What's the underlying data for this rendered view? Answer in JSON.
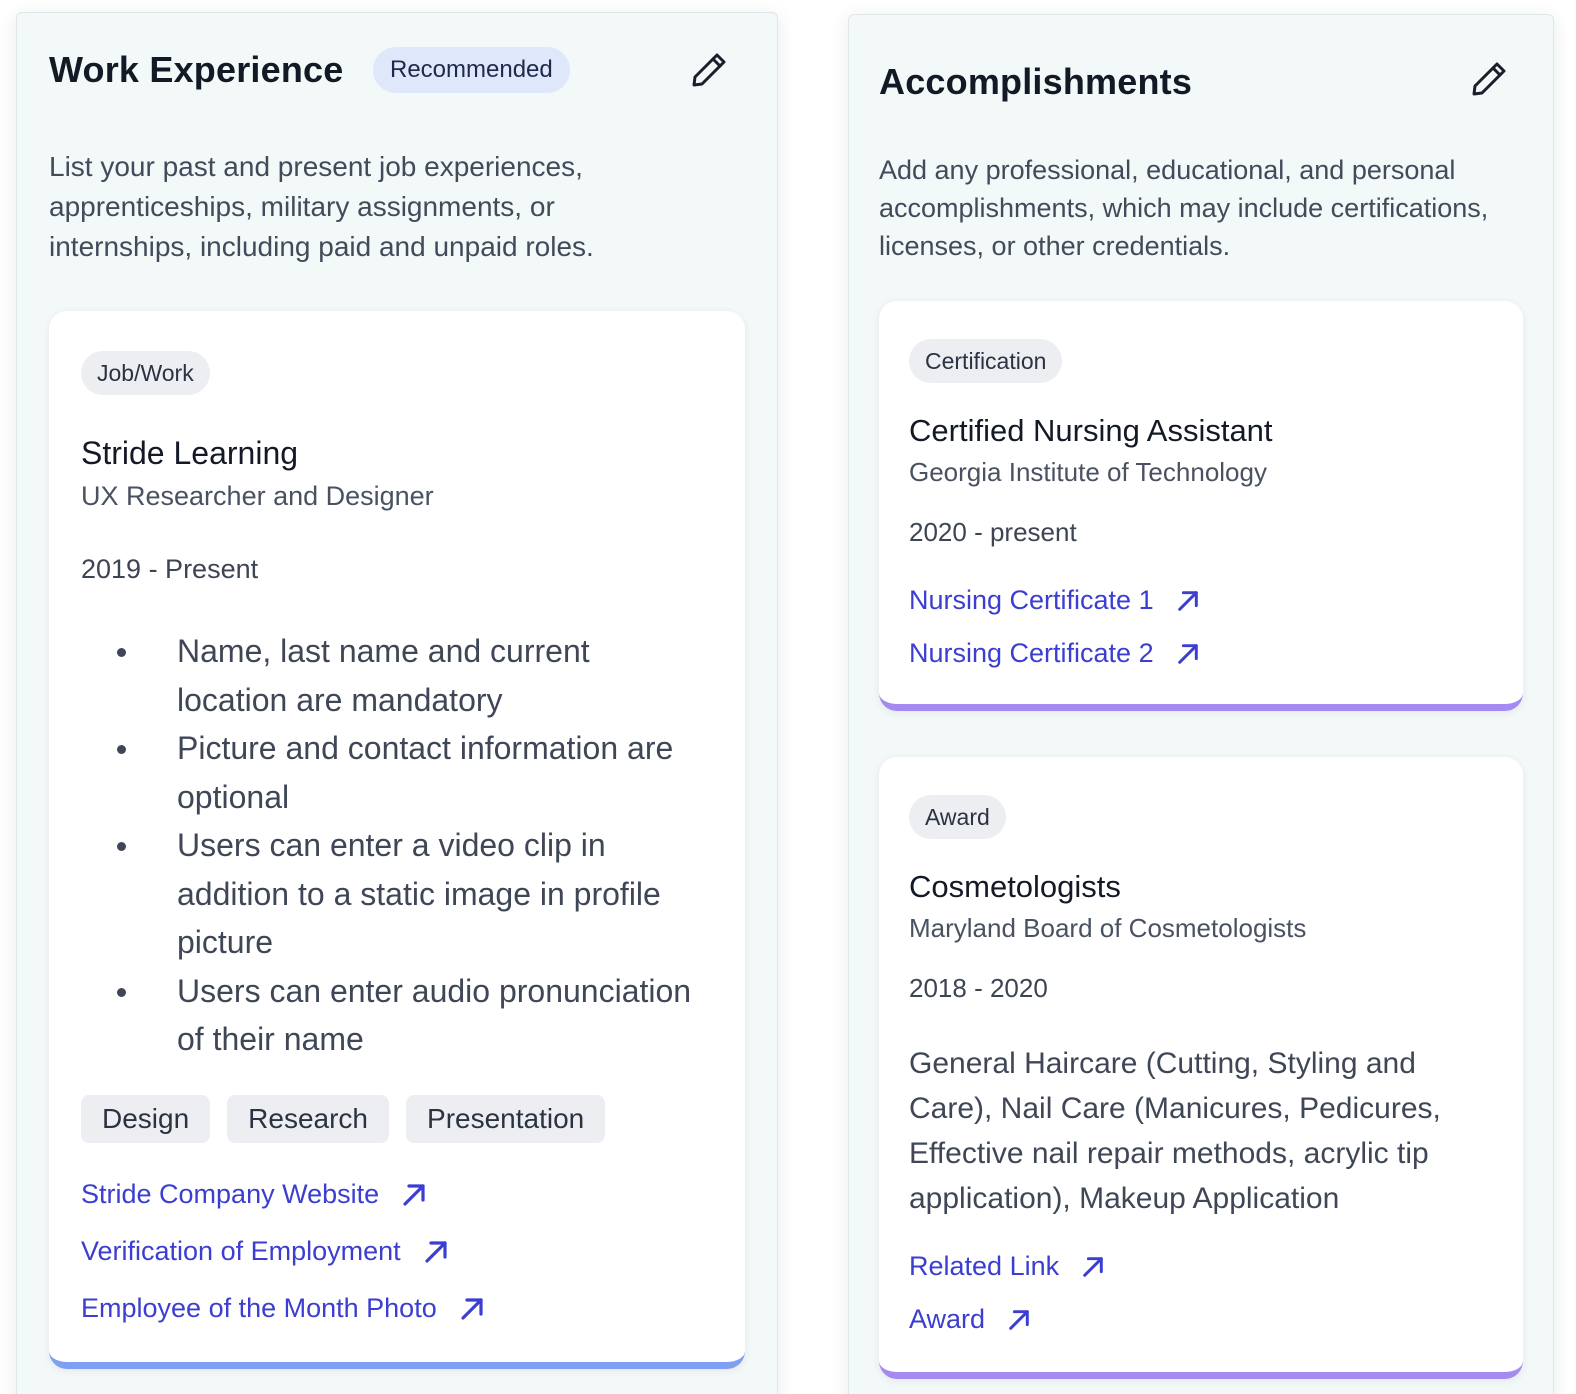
{
  "work": {
    "title": "Work Experience",
    "badge": "Recommended",
    "description": "List your past and present job experiences, apprenticeships, military assignments, or internships, including paid and unpaid roles.",
    "entry": {
      "type": "Job/Work",
      "title": "Stride Learning",
      "role": "UX Researcher and Designer",
      "dates": "2019 - Present",
      "bullets": [
        "Name, last name and current location are mandatory",
        "Picture and contact information are optional",
        "Users can enter a video clip in addition to a static image in profile picture",
        "Users can enter audio pronunciation of their name"
      ],
      "skills": [
        "Design",
        "Research",
        "Presentation"
      ],
      "links": [
        "Stride Company Website",
        "Verification of Employment",
        "Employee of the Month Photo"
      ]
    }
  },
  "accomplishments": {
    "title": "Accomplishments",
    "description": "Add any professional, educational, and personal accomplishments, which may include certifications, licenses, or other credentials.",
    "items": [
      {
        "type": "Certification",
        "title": "Certified Nursing Assistant",
        "issuer": "Georgia Institute of Technology",
        "dates": "2020 - present",
        "links": [
          "Nursing Certificate 1",
          "Nursing Certificate 2"
        ]
      },
      {
        "type": "Award",
        "title": "Cosmetologists",
        "issuer": "Maryland Board of Cosmetologists",
        "dates": "2018 - 2020",
        "details": "General Haircare (Cutting, Styling and Care), Nail Care (Manicures, Pedicures, Effective nail repair methods, acrylic tip application), Makeup Application",
        "links": [
          "Related Link",
          "Award"
        ]
      }
    ]
  },
  "icons": {
    "edit": "pencil-icon",
    "external_link": "arrow-up-right-icon"
  },
  "colors": {
    "link": "#3b3ed0",
    "badge_bg": "#dfe7fb",
    "work_card_accent": "#7f9ff3",
    "accomplishment_card_accent": "#a48af1",
    "panel_bg": "#f3f8f9"
  }
}
